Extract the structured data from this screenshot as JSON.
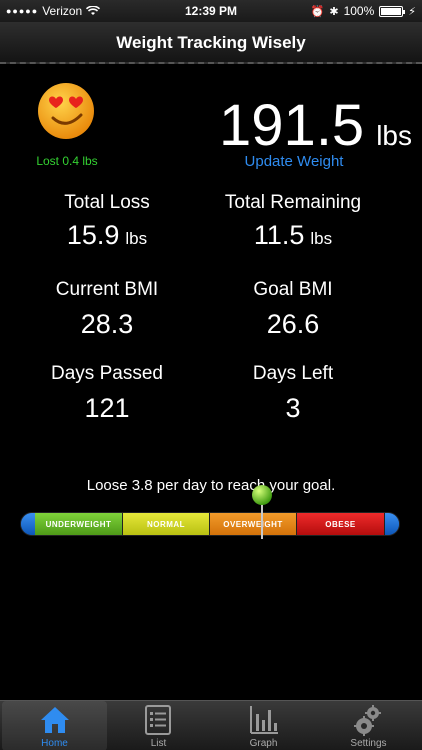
{
  "status_bar": {
    "carrier": "Verizon",
    "time": "12:39 PM",
    "battery": "100%"
  },
  "nav": {
    "title": "Weight Tracking Wisely"
  },
  "summary": {
    "lost_text": "Lost 0.4 lbs",
    "weight_value": "191.5",
    "weight_unit": "lbs",
    "update_label": "Update Weight"
  },
  "stats": {
    "total_loss": {
      "label": "Total Loss",
      "value": "15.9",
      "unit": "lbs"
    },
    "total_remaining": {
      "label": "Total Remaining",
      "value": "11.5",
      "unit": "lbs"
    },
    "current_bmi": {
      "label": "Current BMI",
      "value": "28.3"
    },
    "goal_bmi": {
      "label": "Goal BMI",
      "value": "26.6"
    },
    "days_passed": {
      "label": "Days Passed",
      "value": "121"
    },
    "days_left": {
      "label": "Days Left",
      "value": "3"
    }
  },
  "hint": "Loose 3.8 per day to reach your goal.",
  "bmi_scale": {
    "segments": [
      "UNDERWEIGHT",
      "NORMAL",
      "OVERWEIGHT",
      "OBESE"
    ],
    "colors": {
      "underweight": "#6cc12a",
      "normal": "#d6dc22",
      "overweight": "#e8861a",
      "obese": "#d81a1a"
    }
  },
  "tabs": [
    {
      "label": "Home",
      "icon": "house-icon",
      "active": true
    },
    {
      "label": "List",
      "icon": "list-icon",
      "active": false
    },
    {
      "label": "Graph",
      "icon": "bar-graph-icon",
      "active": false
    },
    {
      "label": "Settings",
      "icon": "gears-icon",
      "active": false
    }
  ],
  "colors": {
    "accent": "#2f8cf0",
    "positive": "#34d232"
  }
}
